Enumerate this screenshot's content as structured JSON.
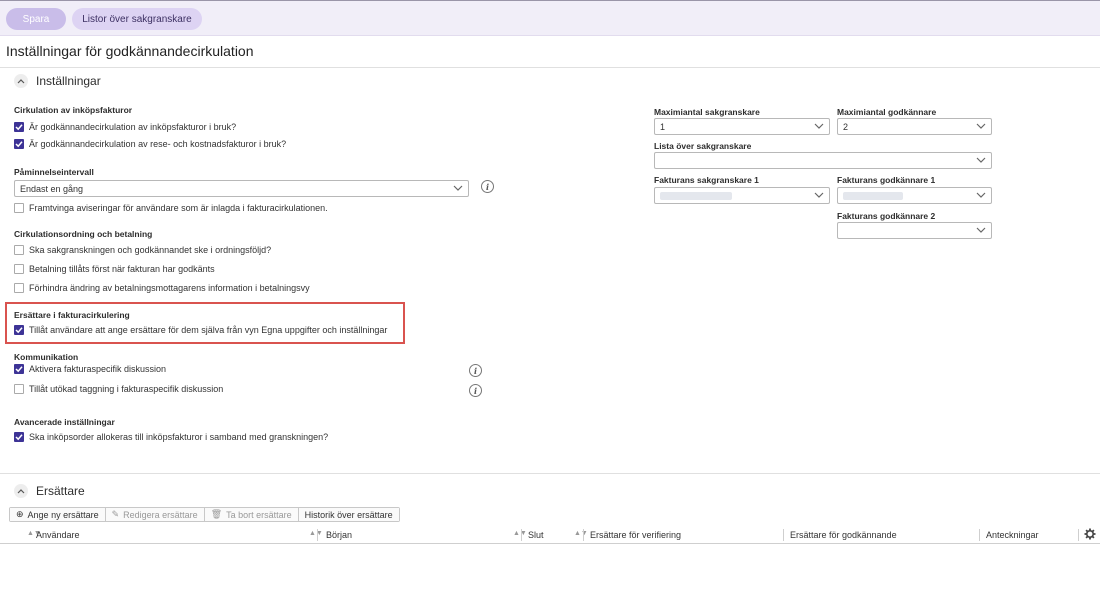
{
  "toolbar": {
    "save_label": "Spara",
    "lists_label": "Listor över sakgranskare"
  },
  "page_title": "Inställningar för godkännandecirkulation",
  "settings": {
    "heading": "Inställningar",
    "circulation_invoices": {
      "label": "Cirkulation av inköpsfakturor",
      "items": [
        {
          "label": "Är godkännandecirkulation av inköpsfakturor i bruk?",
          "checked": true
        },
        {
          "label": "Är godkännandecirkulation av rese- och kostnadsfakturor i bruk?",
          "checked": true
        }
      ]
    },
    "reminder": {
      "label": "Påminnelseintervall",
      "value": "Endast en gång",
      "force_label": "Framtvinga aviseringar för användare som är inlagda i fakturacirkulationen.",
      "force_checked": false
    },
    "order_payment": {
      "label": "Cirkulationsordning och betalning",
      "items": [
        {
          "label": "Ska sakgranskningen och godkännandet ske i ordningsföljd?",
          "checked": false
        },
        {
          "label": "Betalning tillåts först när fakturan har godkänts",
          "checked": false
        },
        {
          "label": "Förhindra ändring av betalningsmottagarens information i betalningsvy",
          "checked": false
        }
      ]
    },
    "substitutes": {
      "label": "Ersättare i fakturacirkulering",
      "item": {
        "label": "Tillåt användare att ange ersättare för dem själva från vyn Egna uppgifter och inställningar",
        "checked": true
      }
    },
    "communication": {
      "label": "Kommunikation",
      "items": [
        {
          "label": "Aktivera fakturaspecifik diskussion",
          "checked": true
        },
        {
          "label": "Tillåt utökad taggning i fakturaspecifik diskussion",
          "checked": false
        }
      ]
    },
    "advanced": {
      "label": "Avancerade inställningar",
      "item": {
        "label": "Ska inköpsorder allokeras till inköpsfakturor i samband med granskningen?",
        "checked": true
      }
    },
    "right": {
      "max_reviewers_label": "Maximiantal sakgranskare",
      "max_reviewers_value": "1",
      "max_approvers_label": "Maximiantal godkännare",
      "max_approvers_value": "2",
      "reviewer_list_label": "Lista över sakgranskare",
      "reviewer_list_value": "",
      "invoice_reviewer1_label": "Fakturans sakgranskare 1",
      "invoice_approver1_label": "Fakturans godkännare 1",
      "invoice_approver2_label": "Fakturans godkännare 2"
    }
  },
  "substitutes_section": {
    "heading": "Ersättare",
    "buttons": {
      "add": "Ange ny ersättare",
      "edit": "Redigera ersättare",
      "delete": "Ta bort ersättare",
      "history": "Historik över ersättare"
    },
    "columns": [
      "Användare",
      "Början",
      "Slut",
      "Ersättare för verifiering",
      "Ersättare för godkännande",
      "Anteckningar"
    ]
  },
  "colors": {
    "accent": "#3d3396",
    "pill_save": "#c9bde9",
    "pill_lists": "#ddd3f3",
    "highlight": "#d9534f"
  },
  "icons": [
    "chevron-up-icon",
    "chevron-down-icon",
    "info-icon",
    "add-icon",
    "edit-icon",
    "trash-icon",
    "gear-icon",
    "sort-icon"
  ]
}
